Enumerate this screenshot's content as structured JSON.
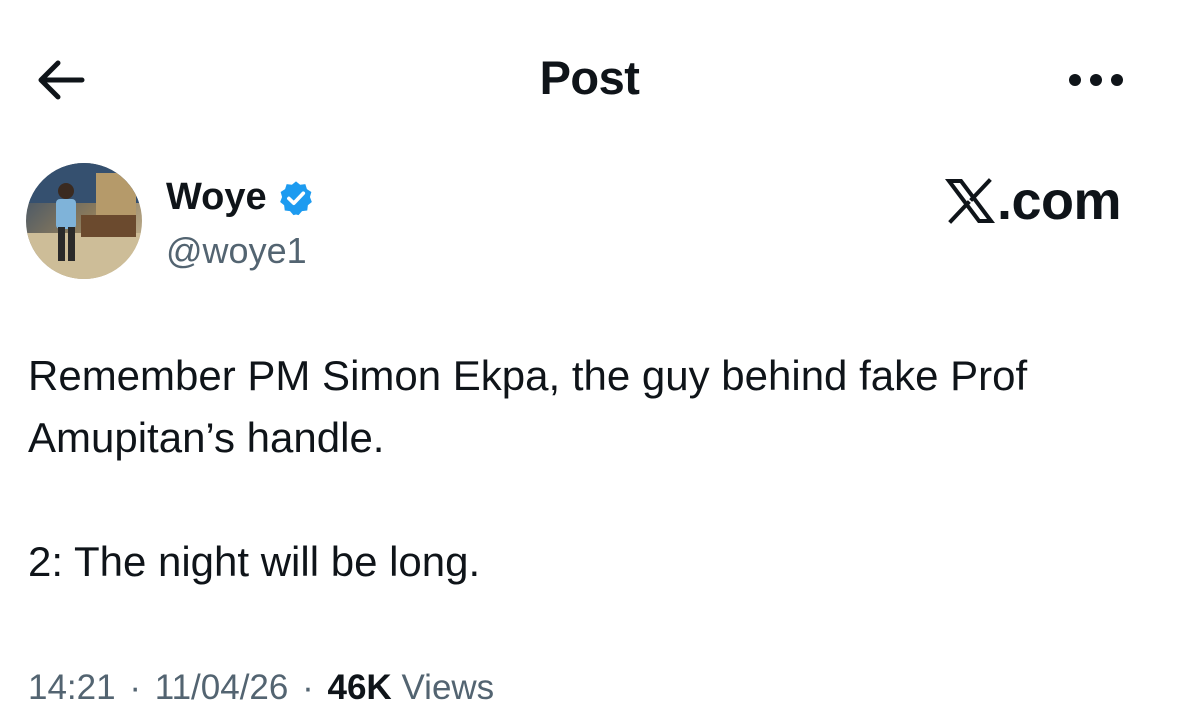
{
  "header": {
    "title": "Post",
    "back_icon": "arrow-left-icon",
    "more_icon": "more-horizontal-icon"
  },
  "author": {
    "name": "Woye",
    "handle": "@woye1",
    "verified": true,
    "verified_color": "#1d9bf0"
  },
  "watermark": {
    "text": ".com",
    "logo": "x-logo-icon"
  },
  "post": {
    "paragraph_1_line_1": "Remember PM Simon Ekpa, the guy behind fake Prof",
    "paragraph_1_line_2": "Amupitan’s handle.",
    "paragraph_2": "2: The night will be long."
  },
  "meta": {
    "time": "14:21",
    "date": "11/04/26",
    "separator": "·",
    "views_count": "46K",
    "views_label": "Views"
  }
}
